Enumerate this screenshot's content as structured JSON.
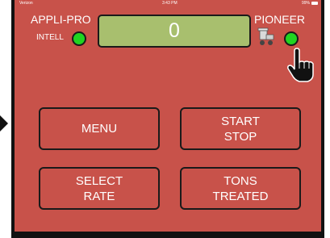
{
  "status": {
    "carrier": "Verizon",
    "time": "3:43 PM",
    "battery": "99%"
  },
  "header": {
    "left_brand": "APPLI-PRO",
    "intell_label": "INTELL",
    "right_brand": "PIONEER",
    "display_value": "0"
  },
  "indicators": {
    "left_led_color": "#21d421",
    "right_led_color": "#21d421"
  },
  "buttons": {
    "menu": {
      "line1": "MENU"
    },
    "start_stop": {
      "line1": "START",
      "line2": "STOP"
    },
    "select_rate": {
      "line1": "SELECT",
      "line2": "RATE"
    },
    "tons_treated": {
      "line1": "TONS",
      "line2": "TREATED"
    }
  },
  "icons": {
    "cart": "cart-icon",
    "hand": "pointing-hand-icon",
    "arrow": "arrow-right-icon"
  },
  "colors": {
    "panel": "#c8524a",
    "display": "#a8bf6e",
    "led": "#21d421"
  }
}
